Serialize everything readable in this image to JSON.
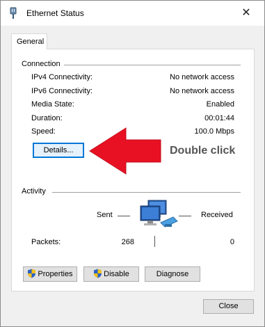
{
  "window": {
    "title": "Ethernet Status",
    "close_glyph": "✕"
  },
  "tabs": [
    {
      "label": "General"
    }
  ],
  "connection": {
    "heading": "Connection",
    "rows": [
      {
        "label": "IPv4 Connectivity:",
        "value": "No network access"
      },
      {
        "label": "IPv6 Connectivity:",
        "value": "No network access"
      },
      {
        "label": "Media State:",
        "value": "Enabled"
      },
      {
        "label": "Duration:",
        "value": "00:01:44"
      },
      {
        "label": "Speed:",
        "value": "100.0 Mbps"
      }
    ],
    "details_button": "Details..."
  },
  "annotation": {
    "text": "Double click",
    "arrow_color": "#e81123"
  },
  "activity": {
    "heading": "Activity",
    "sent_label": "Sent",
    "received_label": "Received",
    "packets_label": "Packets:",
    "packets_sent": "268",
    "packets_received": "0"
  },
  "buttons": {
    "properties": "Properties",
    "disable": "Disable",
    "diagnose": "Diagnose",
    "close": "Close"
  },
  "icons": {
    "title": "ethernet-plug-icon",
    "network": "network-computers-icon",
    "shield": "uac-shield-icon"
  },
  "colors": {
    "accent": "#0078d7",
    "window_bg": "#f0f0f0",
    "panel_bg": "#ffffff"
  }
}
